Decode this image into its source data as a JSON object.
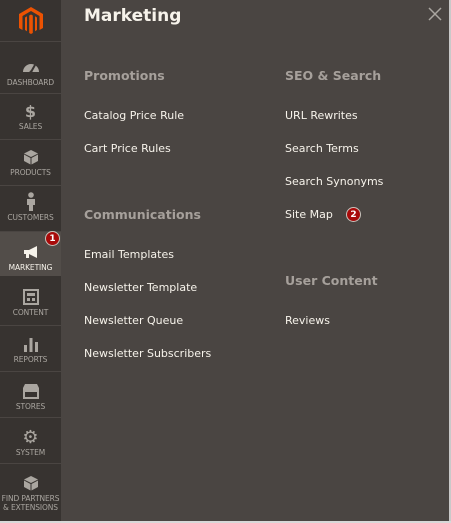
{
  "sidebar": {
    "logo": "magento-logo",
    "items": [
      {
        "label": "DASHBOARD",
        "icon": "dashboard-icon"
      },
      {
        "label": "SALES",
        "icon": "dollar-icon"
      },
      {
        "label": "PRODUCTS",
        "icon": "cube-icon"
      },
      {
        "label": "CUSTOMERS",
        "icon": "person-icon"
      },
      {
        "label": "MARKETING",
        "icon": "megaphone-icon",
        "active": true
      },
      {
        "label": "CONTENT",
        "icon": "layout-icon"
      },
      {
        "label": "REPORTS",
        "icon": "bar-chart-icon"
      },
      {
        "label": "STORES",
        "icon": "storefront-icon"
      },
      {
        "label": "SYSTEM",
        "icon": "gear-icon"
      },
      {
        "label_line1": "FIND PARTNERS",
        "label_line2": "& EXTENSIONS",
        "icon": "partners-cube-icon"
      }
    ],
    "marketing_badge": "1"
  },
  "panel": {
    "title": "Marketing",
    "groups": {
      "promotions": {
        "title": "Promotions",
        "links": [
          "Catalog Price Rule",
          "Cart Price Rules"
        ]
      },
      "communications": {
        "title": "Communications",
        "links": [
          "Email Templates",
          "Newsletter Template",
          "Newsletter Queue",
          "Newsletter Subscribers"
        ]
      },
      "seo": {
        "title": "SEO & Search",
        "links": [
          "URL Rewrites",
          "Search Terms",
          "Search Synonyms",
          "Site Map"
        ]
      },
      "user_content": {
        "title": "User Content",
        "links": [
          "Reviews"
        ]
      }
    },
    "sitemap_badge": "2"
  },
  "colors": {
    "sidebar_bg": "#373330",
    "panel_bg": "#4a4542",
    "active_bg": "#524d49",
    "badge": "#a80a0a",
    "logo": "#eb5202"
  }
}
